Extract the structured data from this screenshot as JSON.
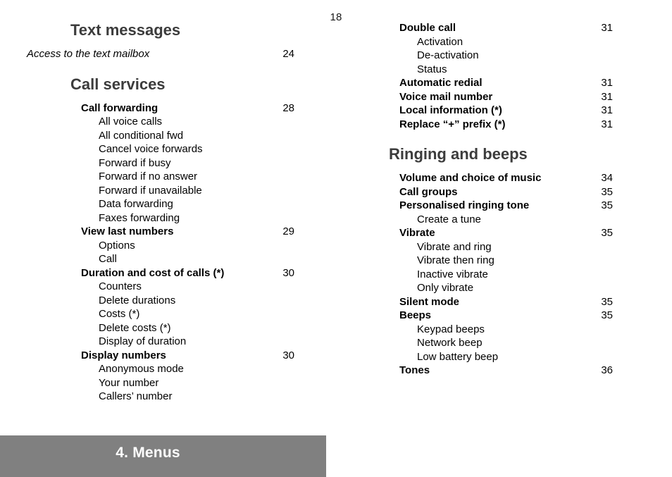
{
  "page": {
    "folio": "18",
    "type": "table-of-contents"
  },
  "chapter_banner": {
    "title": "4. Menus",
    "background_color": "#808080",
    "text_color": "#ffffff"
  },
  "heading_color": "#3c3c3c",
  "left_column": {
    "sections": [
      {
        "heading": "Text messages",
        "entries": [
          {
            "label": "Access to the text mailbox",
            "page": "24",
            "level": 0,
            "style": "italic"
          }
        ]
      },
      {
        "heading": "Call services",
        "entries": [
          {
            "label": "Call forwarding",
            "page": "28",
            "level": 1,
            "style": "bold"
          },
          {
            "label": "All voice calls",
            "page": "",
            "level": 2,
            "style": "normal"
          },
          {
            "label": "All conditional fwd",
            "page": "",
            "level": 2,
            "style": "normal"
          },
          {
            "label": "Cancel voice forwards",
            "page": "",
            "level": 2,
            "style": "normal"
          },
          {
            "label": "Forward if busy",
            "page": "",
            "level": 2,
            "style": "normal"
          },
          {
            "label": "Forward if no answer",
            "page": "",
            "level": 2,
            "style": "normal"
          },
          {
            "label": "Forward if unavailable",
            "page": "",
            "level": 2,
            "style": "normal"
          },
          {
            "label": "Data forwarding",
            "page": "",
            "level": 2,
            "style": "normal"
          },
          {
            "label": "Faxes forwarding",
            "page": "",
            "level": 2,
            "style": "normal"
          },
          {
            "label": "View last numbers",
            "page": "29",
            "level": 1,
            "style": "bold"
          },
          {
            "label": "Options",
            "page": "",
            "level": 2,
            "style": "normal"
          },
          {
            "label": "Call",
            "page": "",
            "level": 2,
            "style": "normal"
          },
          {
            "label": "Duration and cost of calls (*)",
            "page": "30",
            "level": 1,
            "style": "bold"
          },
          {
            "label": "Counters",
            "page": "",
            "level": 2,
            "style": "normal"
          },
          {
            "label": "Delete durations",
            "page": "",
            "level": 2,
            "style": "normal"
          },
          {
            "label": "Costs (*)",
            "page": "",
            "level": 2,
            "style": "normal"
          },
          {
            "label": "Delete costs (*)",
            "page": "",
            "level": 2,
            "style": "normal"
          },
          {
            "label": "Display of duration",
            "page": "",
            "level": 2,
            "style": "normal"
          },
          {
            "label": "Display numbers",
            "page": "30",
            "level": 1,
            "style": "bold"
          },
          {
            "label": "Anonymous mode",
            "page": "",
            "level": 2,
            "style": "normal"
          },
          {
            "label": "Your number",
            "page": "",
            "level": 2,
            "style": "normal"
          },
          {
            "label": "Callers’ number",
            "page": "",
            "level": 2,
            "style": "normal"
          }
        ]
      }
    ]
  },
  "right_column": {
    "sections": [
      {
        "heading": "",
        "entries": [
          {
            "label": "Double call",
            "page": "31",
            "level": 1,
            "style": "bold"
          },
          {
            "label": "Activation",
            "page": "",
            "level": 2,
            "style": "normal"
          },
          {
            "label": "De-activation",
            "page": "",
            "level": 2,
            "style": "normal"
          },
          {
            "label": "Status",
            "page": "",
            "level": 2,
            "style": "normal"
          },
          {
            "label": "Automatic redial",
            "page": "31",
            "level": 1,
            "style": "bold"
          },
          {
            "label": "Voice mail number",
            "page": "31",
            "level": 1,
            "style": "bold"
          },
          {
            "label": "Local information (*)",
            "page": "31",
            "level": 1,
            "style": "bold"
          },
          {
            "label": "Replace “+” prefix (*)",
            "page": "31",
            "level": 1,
            "style": "bold"
          }
        ]
      },
      {
        "heading": "Ringing and beeps",
        "entries": [
          {
            "label": "Volume and choice of music",
            "page": "34",
            "level": 1,
            "style": "bold"
          },
          {
            "label": "Call groups",
            "page": "35",
            "level": 1,
            "style": "bold"
          },
          {
            "label": "Personalised ringing tone",
            "page": "35",
            "level": 1,
            "style": "bold"
          },
          {
            "label": "Create a tune",
            "page": "",
            "level": 2,
            "style": "normal"
          },
          {
            "label": "Vibrate",
            "page": "35",
            "level": 1,
            "style": "bold"
          },
          {
            "label": "Vibrate and ring",
            "page": "",
            "level": 2,
            "style": "normal"
          },
          {
            "label": "Vibrate then ring",
            "page": "",
            "level": 2,
            "style": "normal"
          },
          {
            "label": "Inactive vibrate",
            "page": "",
            "level": 2,
            "style": "normal"
          },
          {
            "label": "Only vibrate",
            "page": "",
            "level": 2,
            "style": "normal"
          },
          {
            "label": "Silent mode",
            "page": "35",
            "level": 1,
            "style": "bold"
          },
          {
            "label": "Beeps",
            "page": "35",
            "level": 1,
            "style": "bold"
          },
          {
            "label": "Keypad beeps",
            "page": "",
            "level": 2,
            "style": "normal"
          },
          {
            "label": "Network beep",
            "page": "",
            "level": 2,
            "style": "normal"
          },
          {
            "label": "Low battery beep",
            "page": "",
            "level": 2,
            "style": "normal"
          },
          {
            "label": "Tones",
            "page": "36",
            "level": 1,
            "style": "bold"
          }
        ]
      }
    ]
  }
}
